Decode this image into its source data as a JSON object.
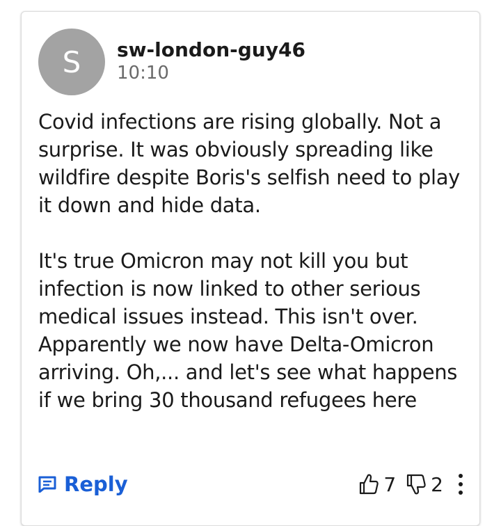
{
  "comment": {
    "avatar_initial": "S",
    "username": "sw-london-guy46",
    "timestamp": "10:10",
    "paragraphs": [
      "Covid infections are rising globally. Not a surprise. It was obviously spreading like wildfire despite Boris's selfish need to play it down and hide data.",
      "It's true Omicron may not kill you but infection is now linked to other serious medical issues instead. This isn't over. Apparently we now have Delta-Omicron arriving. Oh,... and let's see what happens if we bring 30 thousand refugees here"
    ],
    "reply_label": "Reply",
    "upvotes": "7",
    "downvotes": "2"
  },
  "icons": {
    "reply": "comment-icon",
    "upvote": "thumbs-up-icon",
    "downvote": "thumbs-down-icon",
    "more": "more-vertical-icon"
  },
  "colors": {
    "accent": "#1a5fd6",
    "avatar_bg": "#a3a3a3",
    "text": "#1a1a1a",
    "muted": "#6a6a6a"
  }
}
